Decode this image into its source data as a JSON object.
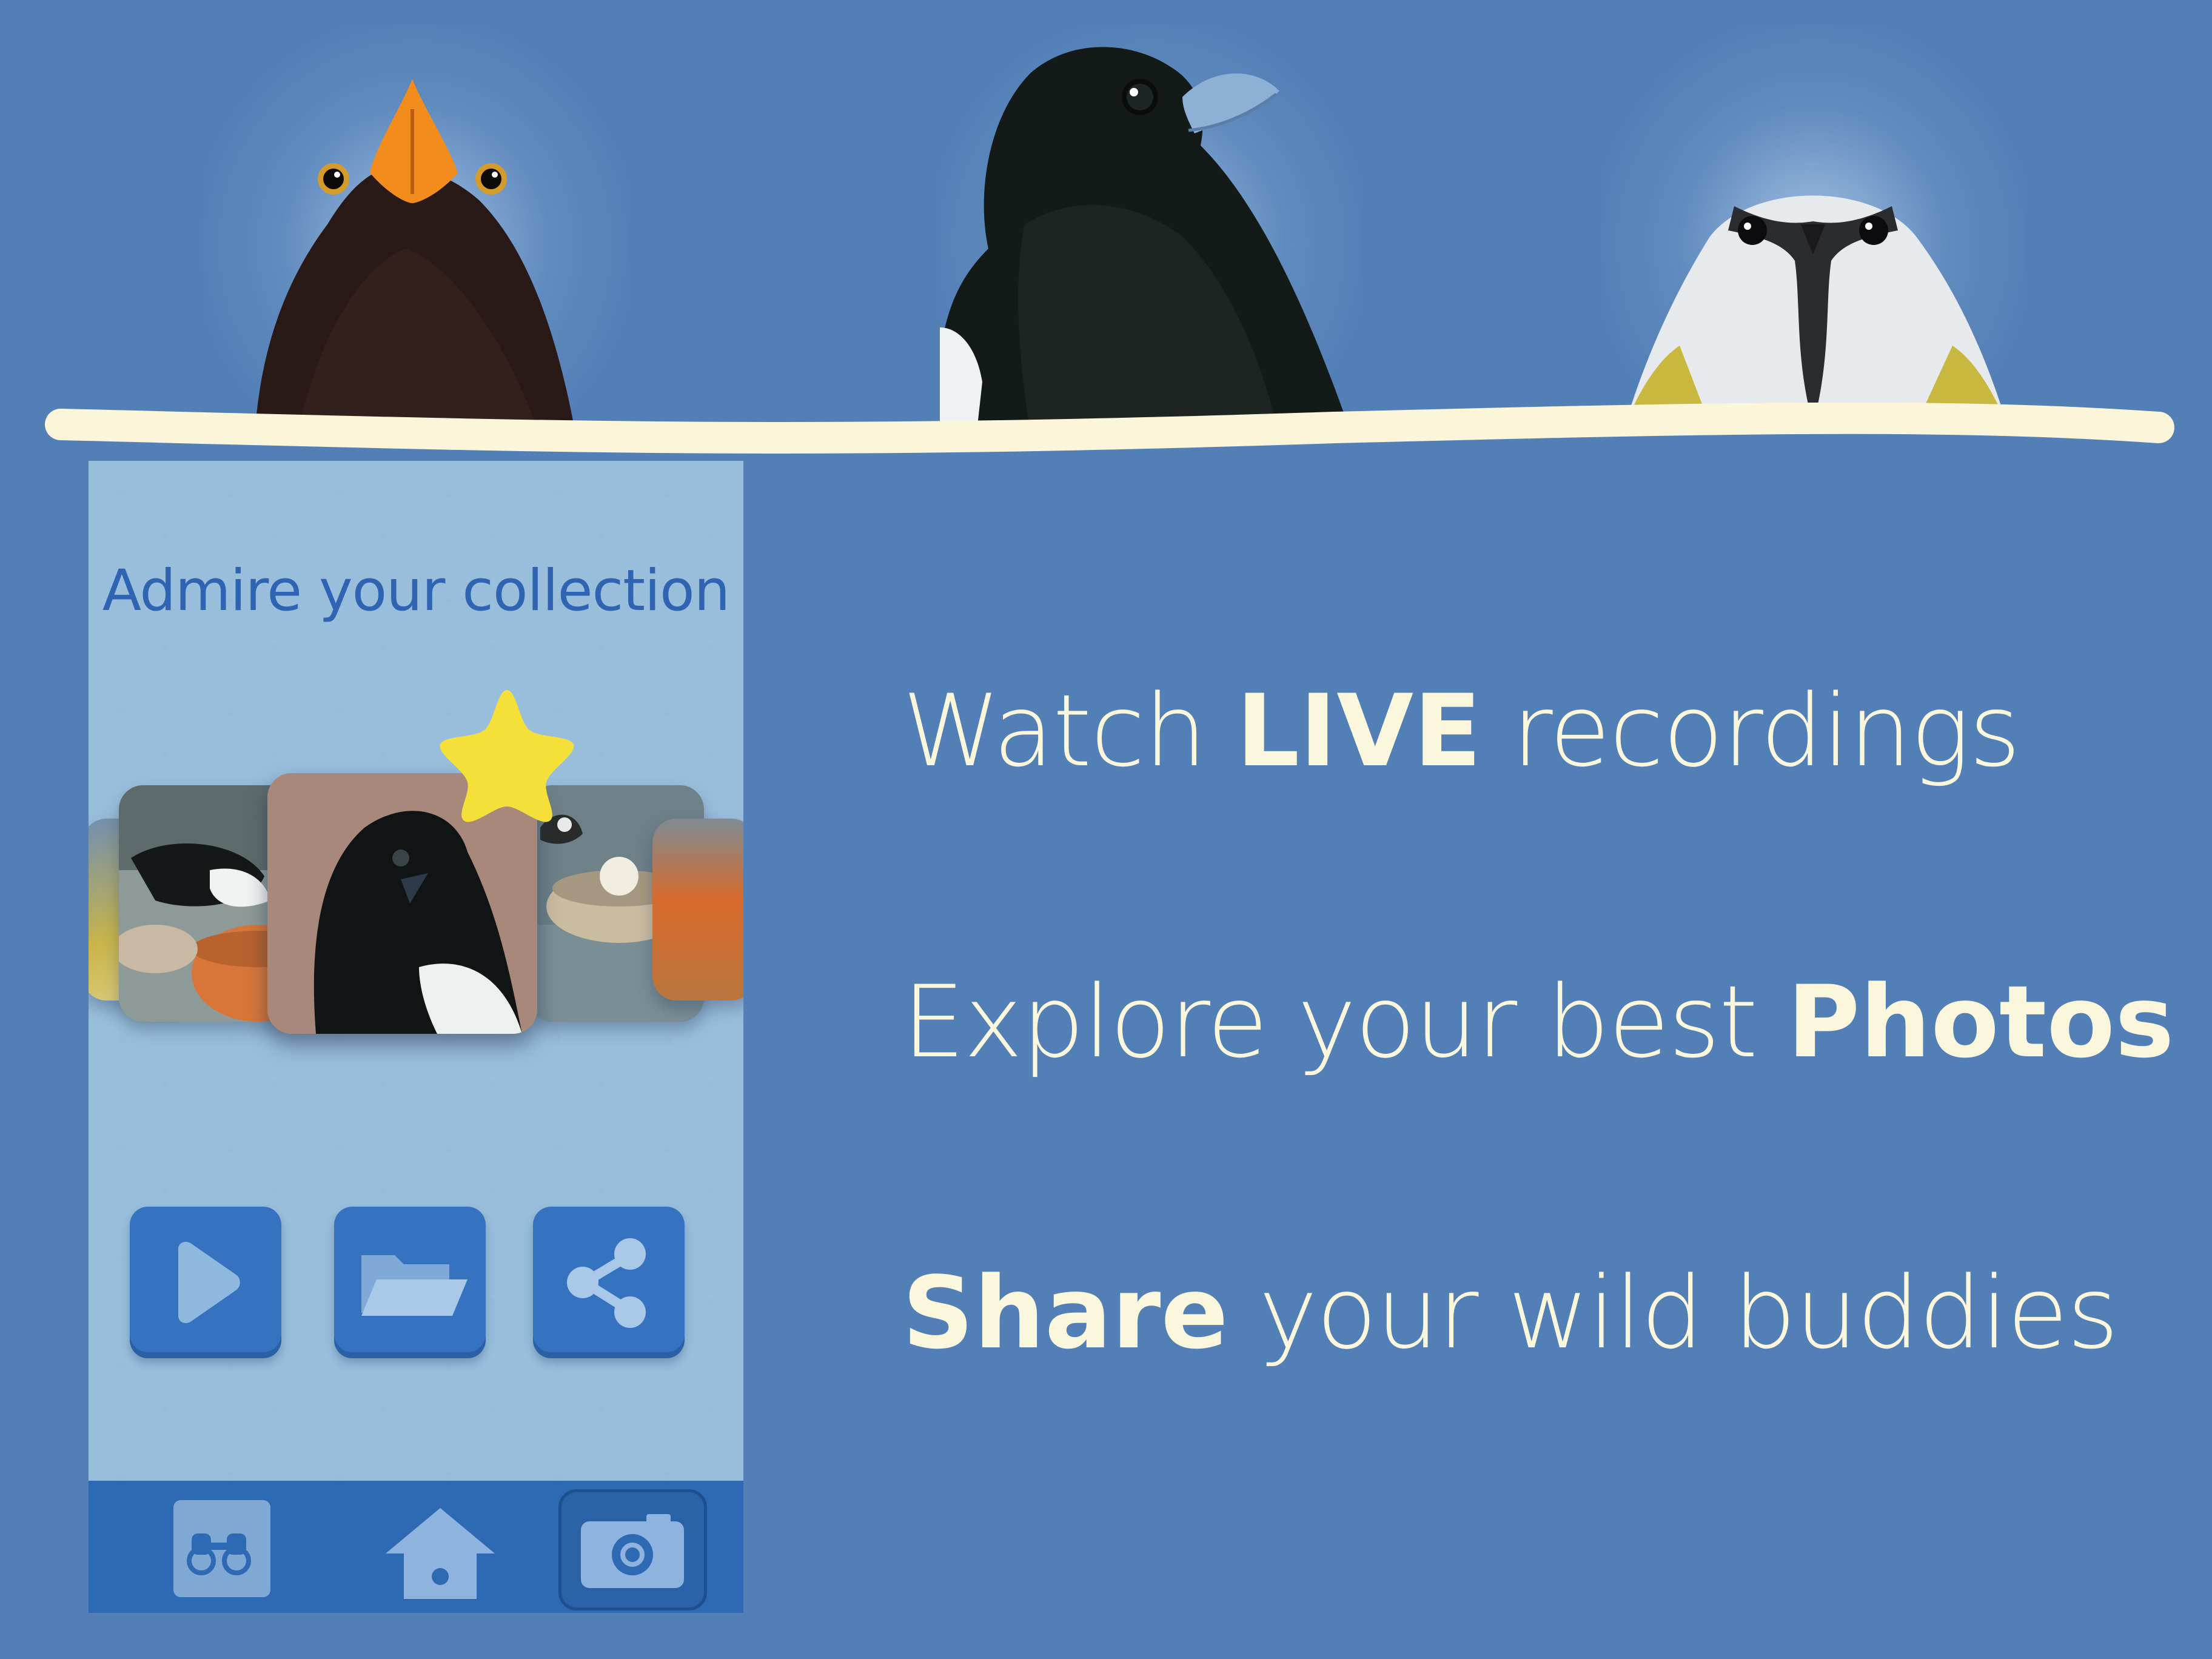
{
  "colors": {
    "background": "#527fb6",
    "perch": "#fbf6da",
    "phone_background": "#99bedc",
    "accent_blue": "#3573c1",
    "title_blue": "#2f64b2",
    "star_yellow": "#f5e03a",
    "tagline_text": "#fbf7dc"
  },
  "hero": {
    "birds": [
      "blackbird",
      "magpie",
      "blue-tit"
    ]
  },
  "phone": {
    "title": "Admire your collection",
    "carousel": {
      "photos": [
        "blue-tit-photo",
        "magpie-at-feeder-photo",
        "magpie-portrait-photo",
        "great-tit-at-feeder-photo",
        "robin-photo"
      ],
      "selected_index": 2,
      "favorite_icon": "star-icon"
    },
    "controls": [
      {
        "icon": "play-icon"
      },
      {
        "icon": "folder-icon"
      },
      {
        "icon": "share-icon"
      }
    ],
    "tabbar": [
      {
        "icon": "binoculars-icon"
      },
      {
        "icon": "home-icon"
      },
      {
        "icon": "camera-icon",
        "active": true
      }
    ]
  },
  "features": {
    "line1": {
      "pre": "Watch ",
      "bold": "LIVE",
      "post": " recordings"
    },
    "line2": {
      "pre": "Explore your best ",
      "bold": "Photos",
      "post": ""
    },
    "line3": {
      "pre": "",
      "bold": "Share",
      "post": " your wild buddies"
    }
  }
}
